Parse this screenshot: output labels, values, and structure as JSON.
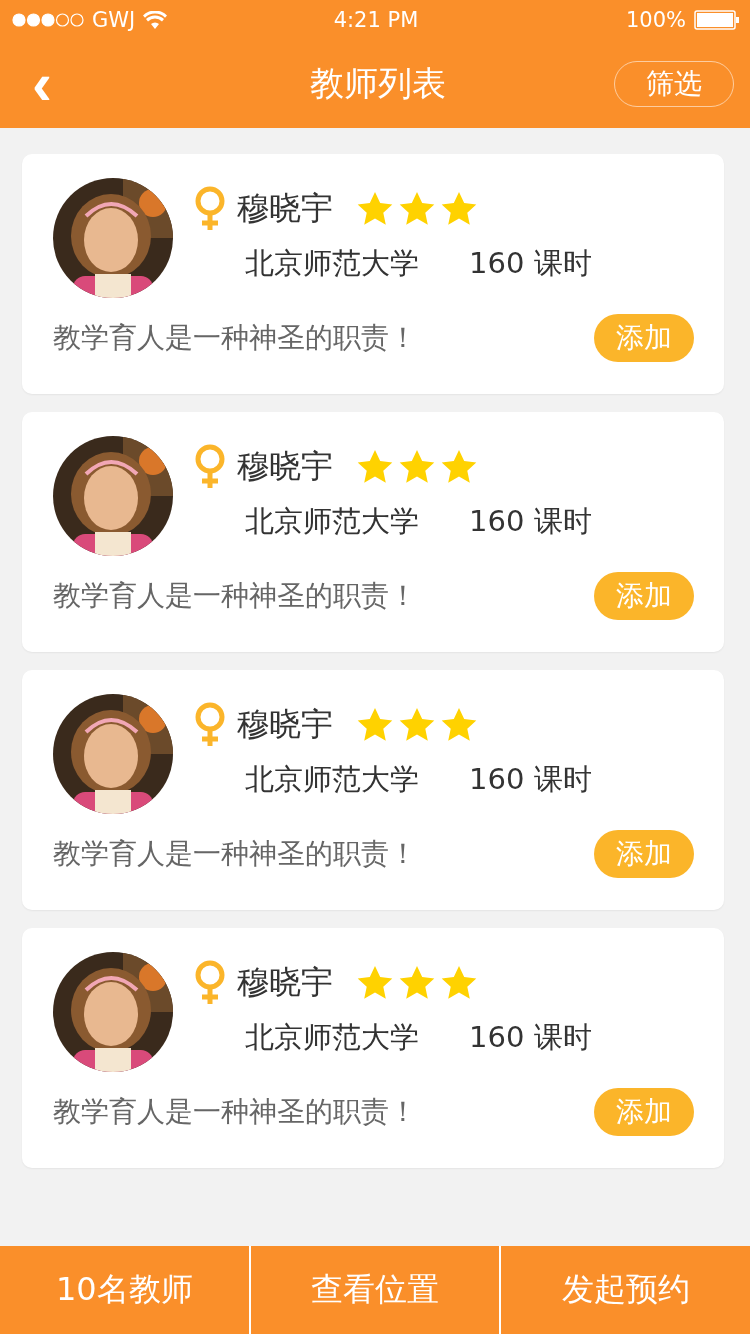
{
  "status_bar": {
    "carrier": "GWJ",
    "time": "4:21 PM",
    "battery": "100%"
  },
  "nav": {
    "back": "‹",
    "title": "教师列表",
    "filter": "筛选"
  },
  "teachers": [
    {
      "name": "穆晓宇",
      "stars": 3,
      "school": "北京师范大学",
      "hours": "160 课时",
      "motto": "教学育人是一种神圣的职责！",
      "action": "添加"
    },
    {
      "name": "穆晓宇",
      "stars": 3,
      "school": "北京师范大学",
      "hours": "160 课时",
      "motto": "教学育人是一种神圣的职责！",
      "action": "添加"
    },
    {
      "name": "穆晓宇",
      "stars": 3,
      "school": "北京师范大学",
      "hours": "160 课时",
      "motto": "教学育人是一种神圣的职责！",
      "action": "添加"
    },
    {
      "name": "穆晓宇",
      "stars": 3,
      "school": "北京师范大学",
      "hours": "160 课时",
      "motto": "教学育人是一种神圣的职责！",
      "action": "添加"
    }
  ],
  "bottom_bar": [
    "10名教师",
    "查看位置",
    "发起预约"
  ]
}
